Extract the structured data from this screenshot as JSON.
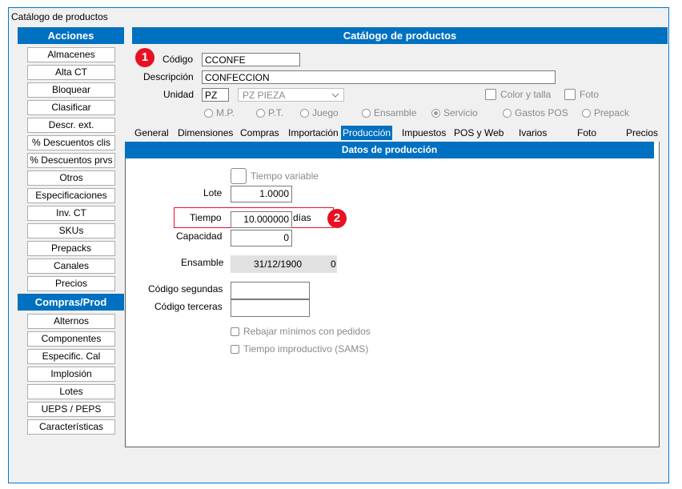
{
  "window": {
    "title": "Catálogo de productos"
  },
  "sidebar": {
    "acciones_header": "Acciones",
    "acciones": [
      "Almacenes",
      "Alta CT",
      "Bloquear",
      "Clasificar",
      "Descr. ext.",
      "% Descuentos clis",
      "% Descuentos prvs",
      "Otros",
      "Especificaciones",
      "Inv. CT",
      "SKUs",
      "Prepacks",
      "Canales",
      "Precios"
    ],
    "compras_header": "Compras/Prod",
    "compras": [
      "Alternos",
      "Componentes",
      "Especific. Cal",
      "Implosión",
      "Lotes",
      "UEPS / PEPS",
      "Características"
    ]
  },
  "main": {
    "header": "Catálogo de productos",
    "codigo_label": "Código",
    "codigo_value": "CCONFE",
    "descripcion_label": "Descripción",
    "descripcion_value": "CONFECCION",
    "unidad_label": "Unidad",
    "unidad_value": "PZ",
    "unidad_select": "PZ  PIEZA",
    "color_talla": "Color y talla",
    "foto_check": "Foto",
    "radios": [
      {
        "label": "M.P.",
        "selected": false
      },
      {
        "label": "P.T.",
        "selected": false
      },
      {
        "label": "Juego",
        "selected": false
      },
      {
        "label": "Ensamble",
        "selected": false
      },
      {
        "label": "Servicio",
        "selected": true
      },
      {
        "label": "Gastos POS",
        "selected": false
      },
      {
        "label": "Prepack",
        "selected": false
      }
    ],
    "tabs": [
      "General",
      "Dimensiones",
      "Compras",
      "Importación",
      "Producción",
      "Impuestos",
      "POS y Web",
      "Ivarios",
      "Foto",
      "Precios"
    ],
    "active_tab": "Producción"
  },
  "produccion": {
    "header": "Datos de producción",
    "tiempo_variable": "Tiempo variable",
    "lote_label": "Lote",
    "lote_value": "1.0000",
    "tiempo_label": "Tiempo",
    "tiempo_value": "10.000000",
    "tiempo_unit": "días",
    "capacidad_label": "Capacidad",
    "capacidad_value": "0",
    "ensamble_label": "Ensamble",
    "ensamble_date": "31/12/1900",
    "ensamble_num": "0",
    "codigo_segundas_label": "Código segundas",
    "codigo_terceras_label": "Código terceras",
    "rebajar": "Rebajar mínimos con pedidos",
    "tiempo_improductivo": "Tiempo improductivo (SAMS)"
  },
  "annotations": {
    "badge1": "1",
    "badge2": "2"
  },
  "colors": {
    "header_blue": "#0070c0",
    "badge_red": "#e81123",
    "highlight_border": "#e81123"
  }
}
